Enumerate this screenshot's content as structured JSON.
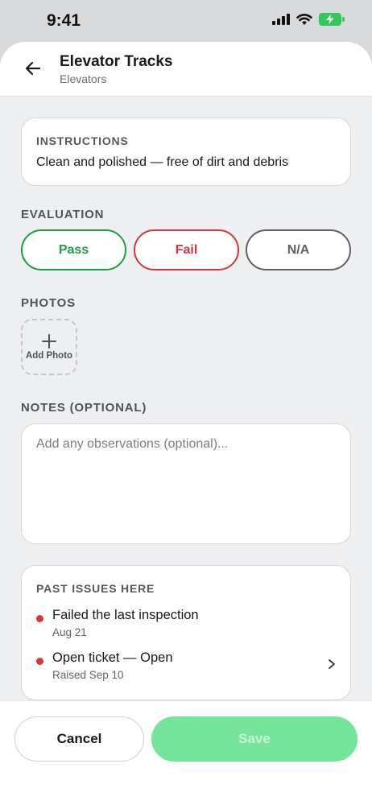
{
  "status_bar": {
    "time": "9:41"
  },
  "header": {
    "title": "Elevator Tracks",
    "subtitle": "Elevators",
    "back_icon": "arrow-left-icon"
  },
  "instructions": {
    "label": "INSTRUCTIONS",
    "text": "Clean and polished — free of dirt and debris"
  },
  "evaluation": {
    "label": "EVALUATION",
    "options": [
      {
        "label": "Pass",
        "color": "#1f9d43"
      },
      {
        "label": "Fail",
        "color": "#d9343c"
      },
      {
        "label": "N/A",
        "color": "#5f6166"
      }
    ]
  },
  "photos": {
    "label": "PHOTOS",
    "add_label": "Add Photo",
    "icon": "plus-icon"
  },
  "notes": {
    "label": "NOTES (OPTIONAL)",
    "placeholder": "Add any observations (optional)...",
    "value": ""
  },
  "past_issues": {
    "label": "PAST ISSUES HERE",
    "items": [
      {
        "title": "Failed the last inspection",
        "subtitle": "Aug 21",
        "has_chevron": false
      },
      {
        "title": "Open ticket — Open",
        "subtitle": "Raised Sep 10",
        "has_chevron": true
      }
    ],
    "status_color": "#d9343c"
  },
  "footer": {
    "cancel_label": "Cancel",
    "save_label": "Save",
    "save_color": "#77e49c"
  }
}
